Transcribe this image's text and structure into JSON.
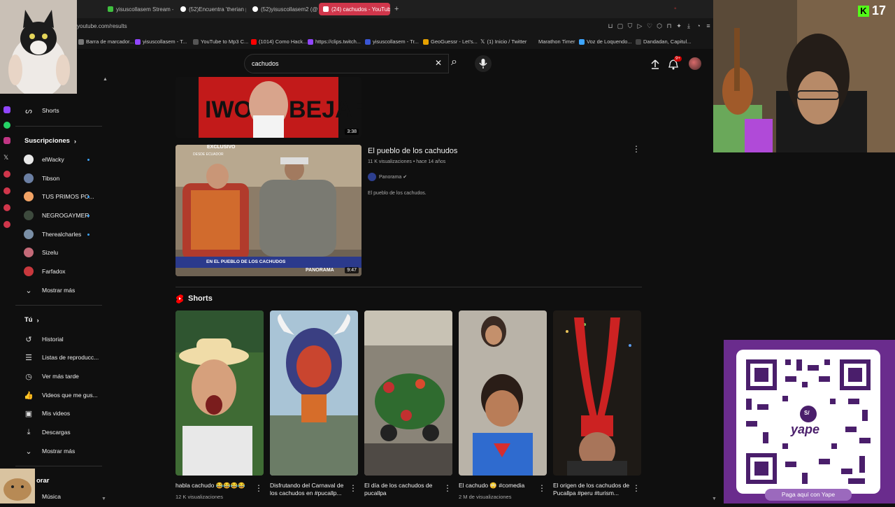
{
  "browser": {
    "tabs": [
      {
        "label": "yisuscollasem Stream - W",
        "color": "#3fbf3f"
      },
      {
        "label": "(52)Encuentra 'therian pe",
        "color": "#ffffff"
      },
      {
        "label": "(52)yisuscollasem2 (@yis",
        "color": "#ffffff"
      },
      {
        "label": "(24) cachudos - YouTube",
        "color": "#ff0000"
      }
    ],
    "new_tab": "+",
    "url": "youtube.com/results",
    "bookmarks": [
      {
        "label": "Barra de marcador..."
      },
      {
        "label": "yisuscollasem - T...",
        "color": "#9146ff"
      },
      {
        "label": "YouTube to Mp3 C..."
      },
      {
        "label": "(1014) Como Hack...",
        "color": "#ff0000"
      },
      {
        "label": "https://clips.twitch...",
        "color": "#9146ff"
      },
      {
        "label": "yisuscollasem - Tr...",
        "color": "#3a56d4"
      },
      {
        "label": "GeoGuessr - Let's...",
        "color": "#e6a100"
      },
      {
        "label": "(1) Inicio / Twitter"
      },
      {
        "label": "Marathon Timer"
      },
      {
        "label": "Voz de Loquendo...",
        "color": "#3ea6ff"
      },
      {
        "label": "Dandadan, Capitul..."
      }
    ]
  },
  "search": {
    "query": "cachudos",
    "clear_icon": "✕",
    "search_icon": "⌕",
    "mic_icon": "🎙"
  },
  "header": {
    "notif_badge": "9+"
  },
  "sidebar": {
    "shorts": "Shorts",
    "subs_title": "Suscripciones",
    "subscriptions": [
      {
        "name": "elWacky",
        "color": "#e8e8e8",
        "live": true
      },
      {
        "name": "Tibson",
        "color": "#6b7fa3",
        "live": false
      },
      {
        "name": "TUS PRIMOS PO...",
        "color": "#f2a365",
        "live": true
      },
      {
        "name": "NEGROGAYMER",
        "color": "#3d4a3d",
        "live": true
      },
      {
        "name": "Therealcharles",
        "color": "#7a8fa6",
        "live": true
      },
      {
        "name": "Sizelu",
        "color": "#c46a78",
        "live": false
      },
      {
        "name": "Farfadox",
        "color": "#c8383d",
        "live": false
      }
    ],
    "show_more": "Mostrar más",
    "you_title": "Tú",
    "you_items": [
      {
        "label": "Historial",
        "icon": "history-icon"
      },
      {
        "label": "Listas de reproducc...",
        "icon": "playlist-icon"
      },
      {
        "label": "Ver más tarde",
        "icon": "clock-icon"
      },
      {
        "label": "Videos que me gus...",
        "icon": "like-icon"
      },
      {
        "label": "Mis videos",
        "icon": "video-icon"
      },
      {
        "label": "Descargas",
        "icon": "download-icon"
      }
    ],
    "show_more_2": "Mostrar más",
    "explore_partial": "orar",
    "music": "Música"
  },
  "results": {
    "top_duration": "3:38",
    "video": {
      "title": "El pueblo de los cachudos",
      "meta": "11 K visualizaciones • hace 14 años",
      "channel": "Panorama ✔",
      "description": "El pueblo de los cachudos.",
      "duration": "9:47",
      "badge": "EXCLUSIVO",
      "badge_sub": "DESDE ECUADOR",
      "caption": "EN EL PUEBLO DE LOS CACHUDOS",
      "brand": "PANORAMA"
    },
    "shorts_title": "Shorts",
    "shorts": [
      {
        "title": "habla cachudo 😂😂😂😂",
        "meta": "12 K visualizaciones"
      },
      {
        "title": "Disfrutando del Carnaval de los cachudos en #pucallp...",
        "meta": ""
      },
      {
        "title": "El día de los cachudos de pucallpa",
        "meta": ""
      },
      {
        "title": "El cachudo 😳 #comedia",
        "meta": "2 M de visualizaciones"
      },
      {
        "title": "El origen de los cachudos de Pucallpa #peru #turism...",
        "meta": ""
      }
    ]
  },
  "stream": {
    "viewer_count": "17",
    "yape_button": "Paga aquí con Yape",
    "yape_logo": "yape",
    "sol_symbol": "S/"
  },
  "colors": {
    "accent_red": "#ff0000",
    "yape_purple": "#6a2c8d",
    "kick_green": "#53fc18"
  }
}
